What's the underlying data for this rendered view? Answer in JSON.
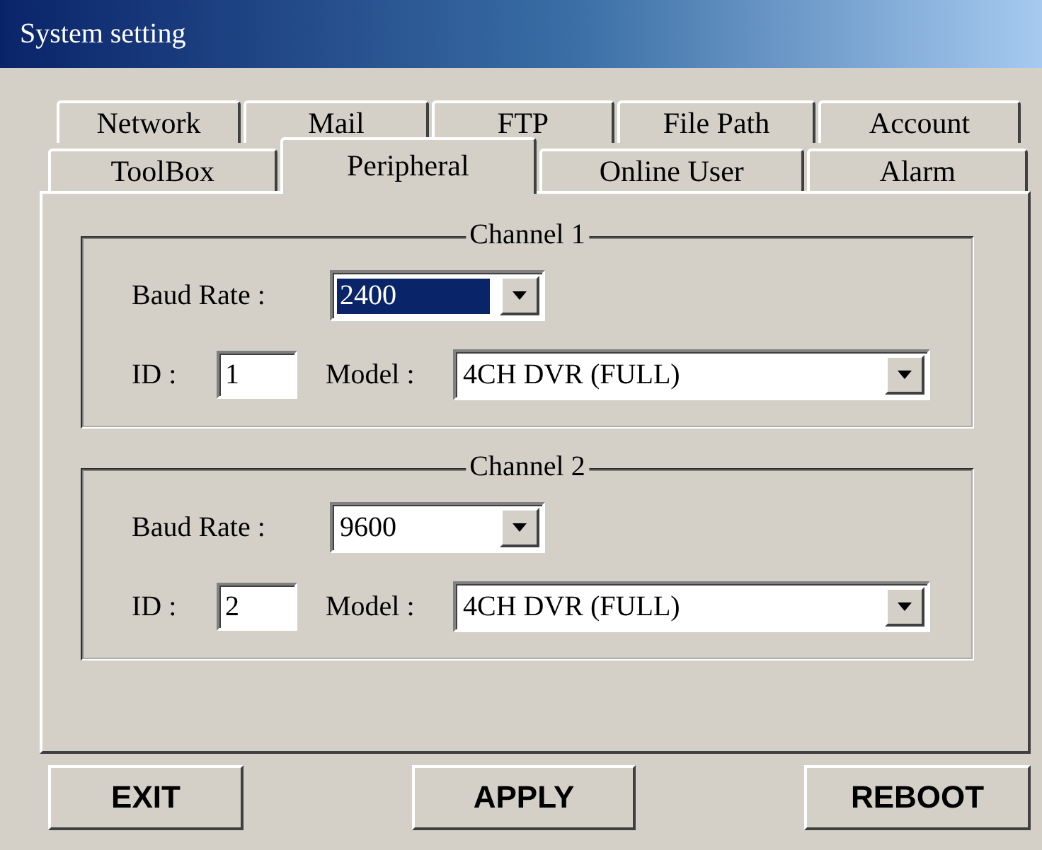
{
  "window": {
    "title": "System setting"
  },
  "tab_rows": [
    [
      {
        "label": "Network",
        "selected": false
      },
      {
        "label": "Mail",
        "selected": false
      },
      {
        "label": "FTP",
        "selected": false
      },
      {
        "label": "File Path",
        "selected": false
      },
      {
        "label": "Account",
        "selected": false
      }
    ],
    [
      {
        "label": "ToolBox",
        "selected": false
      },
      {
        "label": "Peripheral",
        "selected": true
      },
      {
        "label": "Online User",
        "selected": false
      },
      {
        "label": "Alarm",
        "selected": false
      }
    ]
  ],
  "channels": [
    {
      "title": "Channel 1",
      "baud_label": "Baud Rate :",
      "baud_value": "2400",
      "baud_focused": true,
      "id_label": "ID :",
      "id_value": "1",
      "model_label": "Model :",
      "model_value": "4CH DVR (FULL)"
    },
    {
      "title": "Channel 2",
      "baud_label": "Baud Rate :",
      "baud_value": "9600",
      "baud_focused": false,
      "id_label": "ID :",
      "id_value": "2",
      "model_label": "Model :",
      "model_value": "4CH DVR (FULL)"
    }
  ],
  "buttons": [
    "EXIT",
    "APPLY",
    "REBOOT"
  ]
}
